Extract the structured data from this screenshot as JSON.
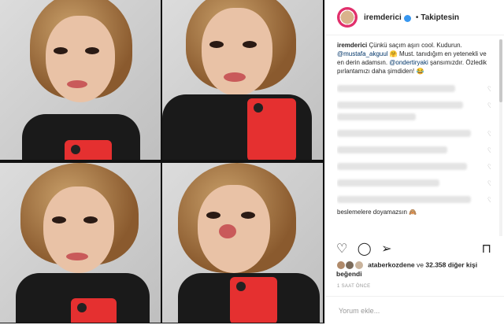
{
  "header": {
    "username": "iremderici",
    "separator": "•",
    "follow_label": "Takiptesin"
  },
  "caption": {
    "username": "iremderici",
    "text_1": "Çünkü saçım aşırı cool. Kudurun.",
    "mention_1": "@mustafa_akguul",
    "text_2": "🤗 Must. tanıdığım en yetenekli ve en derin adamsın.",
    "mention_2": "@ondertiryaki",
    "text_3": "şansımızdır. Özledik pırlantamızı daha şimdiden! 😂"
  },
  "comments_tail": "beslemelere doyamazsın 🙈",
  "likes": {
    "user": "ataberkozdene",
    "connector": "ve",
    "count": "32.358",
    "suffix": "diğer kişi beğendi"
  },
  "timestamp": "1 SAAT ÖNCE",
  "comment_input": {
    "placeholder": "Yorum ekle..."
  },
  "icons": {
    "like": "heart-icon",
    "comment": "comment-icon",
    "share": "share-icon",
    "save": "bookmark-icon"
  },
  "colors": {
    "accent": "#3897f0",
    "mention": "#003569",
    "phone": "#e53030"
  }
}
